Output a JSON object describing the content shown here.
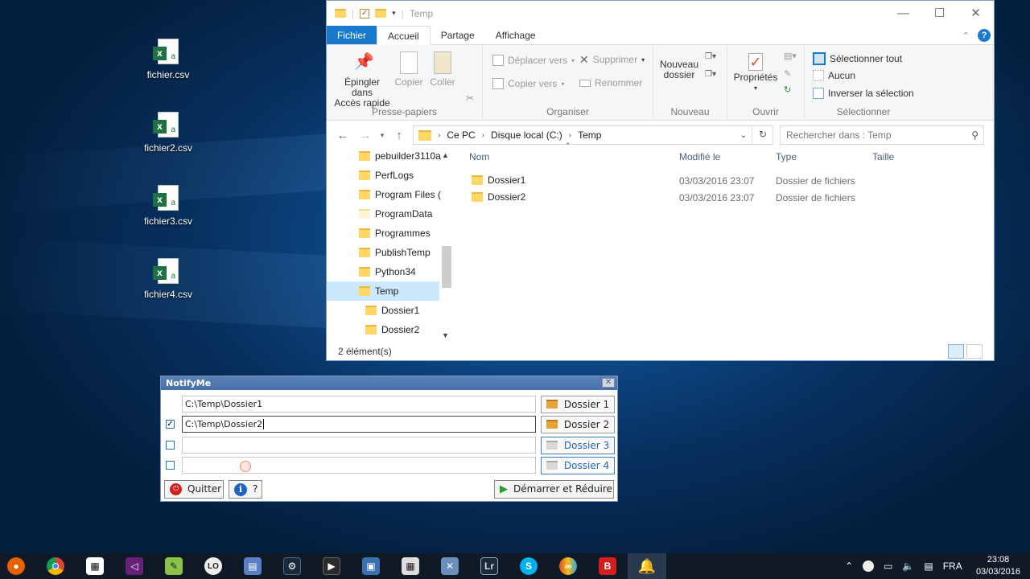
{
  "desktop": {
    "icons": [
      {
        "label": "fichier.csv",
        "icon": "excel-csv-icon"
      },
      {
        "label": "fichier2.csv",
        "icon": "excel-csv-icon"
      },
      {
        "label": "fichier3.csv",
        "icon": "excel-csv-icon"
      },
      {
        "label": "fichier4.csv",
        "icon": "excel-csv-icon"
      }
    ]
  },
  "explorer": {
    "title": "Temp",
    "window_buttons": {
      "minimize": "—",
      "maximize": "☐",
      "close": "✕"
    },
    "tabs": [
      "Fichier",
      "Accueil",
      "Partage",
      "Affichage"
    ],
    "ribbon": {
      "presse_papiers": {
        "label": "Presse-papiers",
        "pin": "Épingler dans",
        "pin2": "Accès rapide",
        "copy": "Copier",
        "paste": "Coller"
      },
      "organiser": {
        "label": "Organiser",
        "move": "Déplacer vers",
        "copy_to": "Copier vers",
        "delete": "Supprimer",
        "rename": "Renommer"
      },
      "nouveau": {
        "label": "Nouveau",
        "new_folder": "Nouveau",
        "new_folder2": "dossier"
      },
      "ouvrir": {
        "label": "Ouvrir",
        "properties": "Propriétés"
      },
      "selectionner": {
        "label": "Sélectionner",
        "select_all": "Sélectionner tout",
        "none": "Aucun",
        "invert": "Inverser la sélection"
      }
    },
    "address": {
      "crumbs": [
        "Ce PC",
        "Disque local (C:)",
        "Temp"
      ],
      "search_placeholder": "Rechercher dans : Temp"
    },
    "tree": [
      {
        "label": "pebuilder3110a",
        "indent": 0,
        "selected": false
      },
      {
        "label": "PerfLogs",
        "indent": 0,
        "selected": false
      },
      {
        "label": "Program Files (",
        "indent": 0,
        "selected": false
      },
      {
        "label": "ProgramData",
        "indent": 0,
        "selected": false,
        "pale": true
      },
      {
        "label": "Programmes",
        "indent": 0,
        "selected": false
      },
      {
        "label": "PublishTemp",
        "indent": 0,
        "selected": false
      },
      {
        "label": "Python34",
        "indent": 0,
        "selected": false
      },
      {
        "label": "Temp",
        "indent": 0,
        "selected": true
      },
      {
        "label": "Dossier1",
        "indent": 1,
        "selected": false
      },
      {
        "label": "Dossier2",
        "indent": 1,
        "selected": false
      }
    ],
    "columns": [
      "Nom",
      "Modifié le",
      "Type",
      "Taille"
    ],
    "rows": [
      {
        "name": "Dossier1",
        "date": "03/03/2016 23:07",
        "type": "Dossier de fichiers"
      },
      {
        "name": "Dossier2",
        "date": "03/03/2016 23:07",
        "type": "Dossier de fichiers"
      }
    ],
    "status": "2 élément(s)"
  },
  "notifyme": {
    "title": "NotifyMe",
    "rows": [
      {
        "checked": null,
        "path": "C:\\Temp\\Dossier1",
        "button": "Dossier 1",
        "active": true
      },
      {
        "checked": true,
        "path": "C:\\Temp\\Dossier2",
        "button": "Dossier 2",
        "active": true
      },
      {
        "checked": false,
        "path": "",
        "button": "Dossier 3",
        "active": false
      },
      {
        "checked": false,
        "path": "",
        "button": "Dossier 4",
        "active": false
      }
    ],
    "quit": "Quitter",
    "help": "?",
    "start": "Démarrer et Réduire"
  },
  "taskbar": {
    "apps": [
      "firefox-icon",
      "chrome-icon",
      "store-icon",
      "visual-studio-icon",
      "notepadpp-icon",
      "libreoffice-icon",
      "paint-icon",
      "steam-icon",
      "terminal-icon",
      "remote-desktop-icon",
      "calculator-icon",
      "tools-icon",
      "lightroom-icon",
      "skype-icon",
      "game-icon",
      "bitdefender-icon",
      "notifyme-bell-icon"
    ],
    "lightroom_label": "Lr",
    "bitdefender_label": "B",
    "language": "FRA",
    "time": "23:08",
    "date": "03/03/2016"
  }
}
